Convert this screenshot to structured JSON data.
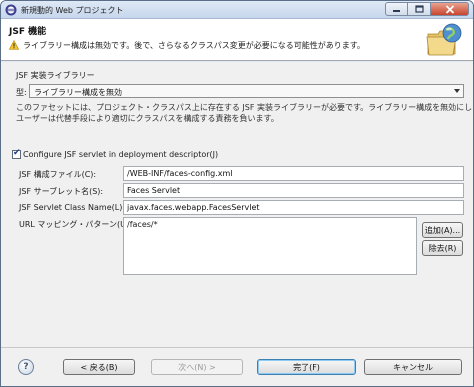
{
  "window": {
    "title": "新規動的 Web プロジェクト",
    "controls": {
      "minimize": "minimize-icon",
      "maximize": "maximize-icon",
      "close": "close-icon"
    }
  },
  "header": {
    "title": "JSF 機能",
    "message": "ライブラリー構成は無効です。後で、さらなるクラスパス変更が必要になる可能性があります。",
    "icon": "warning-icon",
    "banner_icon": "folder-globe-icon"
  },
  "library": {
    "group_label": "JSF 実装ライブラリー",
    "type_label": "型:",
    "type_value": "ライブラリー構成を無効",
    "description_line1": "このファセットには、プロジェクト・クラスパス上に存在する JSF 実装ライブラリーが必要です。ライブラリー構成を無効にした場合、",
    "description_line2": "ユーザーは代替手段により適切にクラスパスを構成する責務を負います。"
  },
  "servlet": {
    "configure_label": "Configure JSF servlet in deployment descriptor(J)",
    "configure_checked": true,
    "config_file_label": "JSF 構成ファイル(C):",
    "config_file_value": "/WEB-INF/faces-config.xml",
    "servlet_name_label": "JSF サーブレット名(S):",
    "servlet_name_value": "Faces Servlet",
    "servlet_class_label": "JSF Servlet Class Name(L):",
    "servlet_class_value": "javax.faces.webapp.FacesServlet",
    "url_mapping_label": "URL マッピング・パターン(U):",
    "url_mappings": [
      "/faces/*"
    ],
    "add_button": "追加(A)...",
    "remove_button": "除去(R)"
  },
  "footer": {
    "help_glyph": "?",
    "back": "< 戻る(B)",
    "next": "次へ(N) >",
    "finish": "完了(F)",
    "cancel": "キャンセル"
  }
}
